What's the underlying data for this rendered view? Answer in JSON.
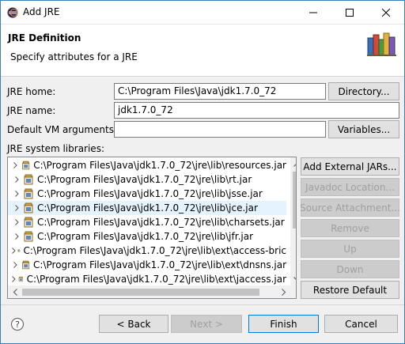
{
  "window": {
    "title": "Add JRE",
    "minimize_glyph": "–",
    "maximize_glyph": "☐",
    "close_glyph": "✕"
  },
  "header": {
    "title": "JRE Definition",
    "description": "Specify attributes for a JRE"
  },
  "form": {
    "jre_home_label": "JRE home:",
    "jre_home_value": "C:\\Program Files\\Java\\jdk1.7.0_72",
    "directory_button": "Directory...",
    "jre_name_label": "JRE name:",
    "jre_name_value": "jdk1.7.0_72",
    "vm_args_label": "Default VM arguments:",
    "vm_args_value": "",
    "variables_button": "Variables...",
    "libraries_label": "JRE system libraries:"
  },
  "libraries": [
    "C:\\Program Files\\Java\\jdk1.7.0_72\\jre\\lib\\resources.jar",
    "C:\\Program Files\\Java\\jdk1.7.0_72\\jre\\lib\\rt.jar",
    "C:\\Program Files\\Java\\jdk1.7.0_72\\jre\\lib\\jsse.jar",
    "C:\\Program Files\\Java\\jdk1.7.0_72\\jre\\lib\\jce.jar",
    "C:\\Program Files\\Java\\jdk1.7.0_72\\jre\\lib\\charsets.jar",
    "C:\\Program Files\\Java\\jdk1.7.0_72\\jre\\lib\\jfr.jar",
    "C:\\Program Files\\Java\\jdk1.7.0_72\\jre\\lib\\ext\\access-bric",
    "C:\\Program Files\\Java\\jdk1.7.0_72\\jre\\lib\\ext\\dnsns.jar",
    "C:\\Program Files\\Java\\jdk1.7.0_72\\jre\\lib\\ext\\jaccess.jar"
  ],
  "selected_library_index": 3,
  "library_buttons": {
    "add_external": "Add External JARs...",
    "javadoc": "Javadoc Location...",
    "source": "Source Attachment...",
    "remove": "Remove",
    "up": "Up",
    "down": "Down",
    "restore": "Restore Default"
  },
  "footer": {
    "back": "< Back",
    "next": "Next >",
    "finish": "Finish",
    "cancel": "Cancel"
  },
  "colors": {
    "selection": "#e5f3ff",
    "window_border": "#3c7fb1",
    "default_button_border": "#0078d7",
    "disabled_text": "#a0a0a0"
  }
}
